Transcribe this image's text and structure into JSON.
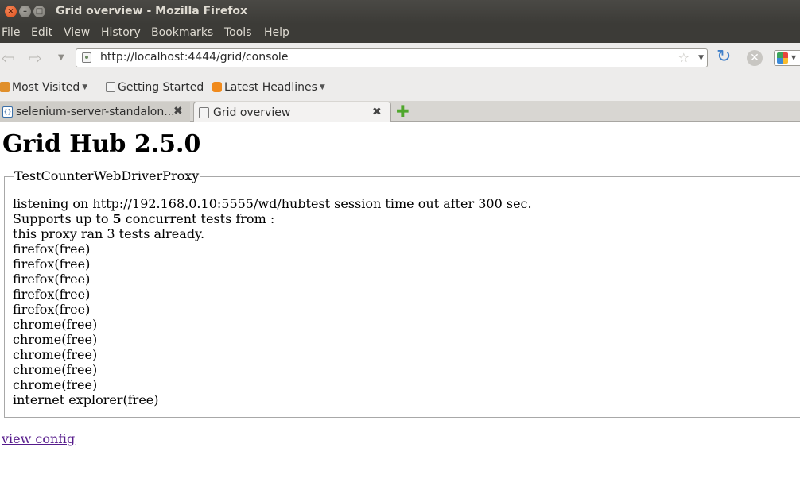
{
  "window": {
    "title": "Grid overview - Mozilla Firefox"
  },
  "menu": {
    "items": [
      "File",
      "Edit",
      "View",
      "History",
      "Bookmarks",
      "Tools",
      "Help"
    ]
  },
  "navigation": {
    "url": "http://localhost:4444/grid/console"
  },
  "bookmarks": {
    "items": [
      "Most Visited",
      "Getting Started",
      "Latest Headlines"
    ]
  },
  "tabs": [
    {
      "label": "selenium-server-standalon...",
      "active": false
    },
    {
      "label": "Grid overview",
      "active": true
    }
  ],
  "page": {
    "title": "Grid Hub 2.5.0",
    "proxy": {
      "legend": "TestCounterWebDriverProxy",
      "listening": "listening on http://192.168.0.10:5555/wd/hubtest session time out after 300 sec.",
      "supports_prefix": "Supports up to ",
      "max_concurrent": "5",
      "supports_suffix": " concurrent tests from :",
      "ran_tests": "this proxy ran 3 tests already.",
      "browsers": [
        "firefox(free)",
        "firefox(free)",
        "firefox(free)",
        "firefox(free)",
        "firefox(free)",
        "chrome(free)",
        "chrome(free)",
        "chrome(free)",
        "chrome(free)",
        "chrome(free)",
        "internet explorer(free)"
      ]
    },
    "view_config_link": "view config"
  }
}
